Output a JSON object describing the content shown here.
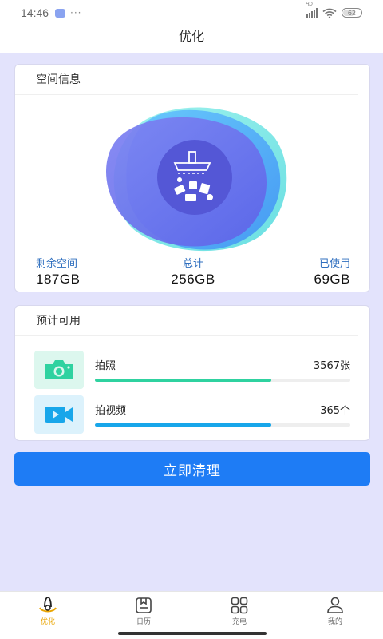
{
  "status_bar": {
    "time": "14:46",
    "dots": "···",
    "battery": "62"
  },
  "header": {
    "title": "优化"
  },
  "space_card": {
    "title": "空间信息",
    "stats": [
      {
        "label": "剩余空间",
        "value": "187GB"
      },
      {
        "label": "总计",
        "value": "256GB"
      },
      {
        "label": "已使用",
        "value": "69GB"
      }
    ]
  },
  "estimate_card": {
    "title": "预计可用",
    "items": [
      {
        "name": "拍照",
        "count": "3567张",
        "progress": 0.69,
        "color": "#2fd2a0",
        "icon": "camera-icon"
      },
      {
        "name": "拍视频",
        "count": "365个",
        "progress": 0.69,
        "color": "#18a6ea",
        "icon": "video-camera-icon"
      }
    ]
  },
  "clean_button": {
    "label": "立即清理"
  },
  "tabs": [
    {
      "label": "优化",
      "icon": "optimize-icon",
      "active": true
    },
    {
      "label": "日历",
      "icon": "calendar-icon",
      "active": false
    },
    {
      "label": "充电",
      "icon": "charge-grid-icon",
      "active": false
    },
    {
      "label": "我的",
      "icon": "profile-icon",
      "active": false
    }
  ],
  "colors": {
    "accent": "#1e7cf5",
    "background": "#e3e3fc",
    "active_tab": "#e9a400",
    "stat_label": "#2f6fbf"
  }
}
